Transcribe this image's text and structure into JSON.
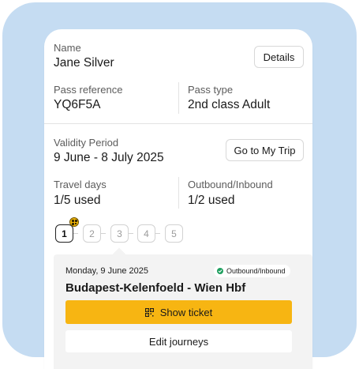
{
  "traveller": {
    "name_label": "Name",
    "name_value": "Jane Silver",
    "details_button": "Details"
  },
  "pass": {
    "reference_label": "Pass reference",
    "reference_value": "YQ6F5A",
    "type_label": "Pass type",
    "type_value": "2nd class Adult"
  },
  "validity": {
    "label": "Validity Period",
    "value": "9 June - 8 July 2025",
    "trip_button": "Go to My Trip"
  },
  "usage": {
    "travel_days_label": "Travel days",
    "travel_days_value": "1/5 used",
    "outbound_label": "Outbound/Inbound",
    "outbound_value": "1/2 used"
  },
  "days": [
    "1",
    "2",
    "3",
    "4",
    "5"
  ],
  "journey": {
    "date": "Monday, 9 June 2025",
    "tag": "Outbound/Inbound",
    "route": "Budapest-Kelenfoeld - Wien Hbf",
    "show_ticket": "Show ticket",
    "edit": "Edit journeys"
  },
  "colors": {
    "background_blob": "#c5dcf2",
    "accent": "#f7b512",
    "status_green": "#20a060"
  },
  "icons": [
    "qr-badge-icon",
    "check-circle-icon",
    "qr-code-icon"
  ]
}
